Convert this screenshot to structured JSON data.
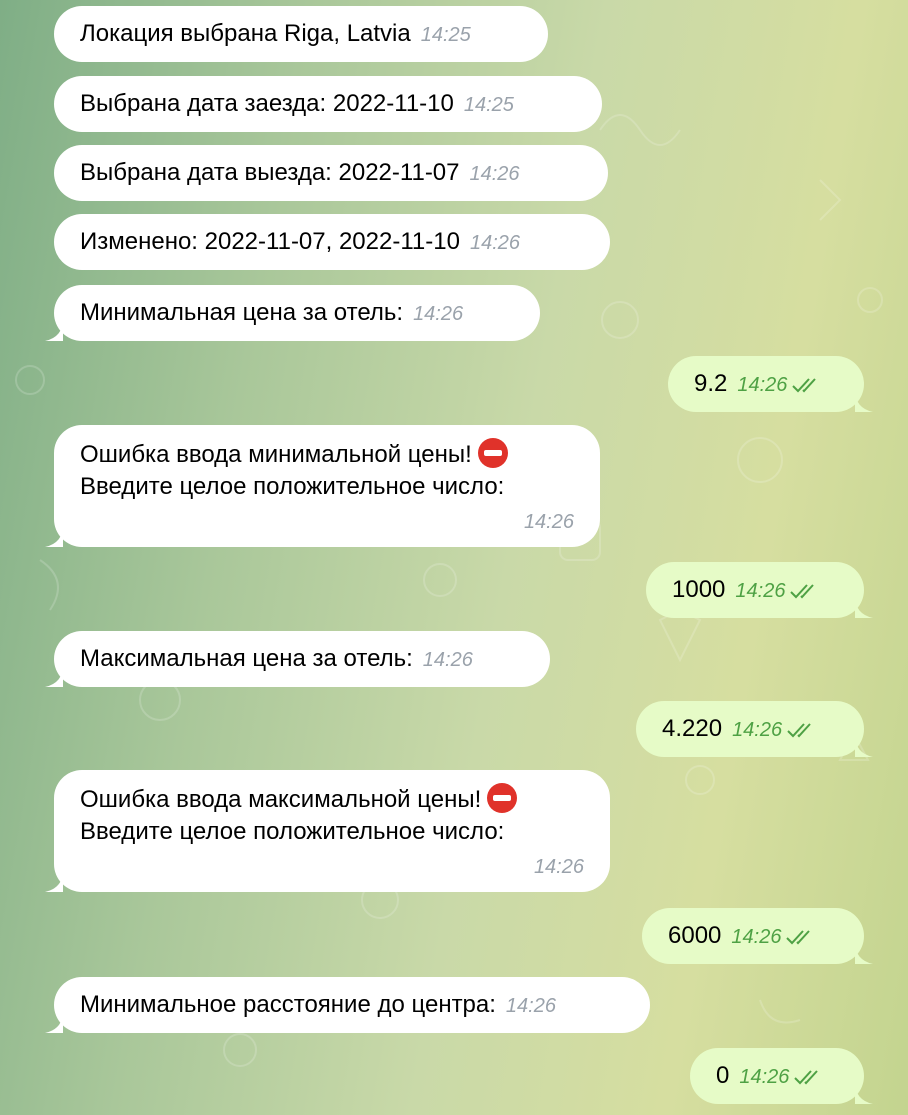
{
  "messages": [
    {
      "dir": "in",
      "text": "Локация выбрана Riga, Latvia",
      "time": "14:25"
    },
    {
      "dir": "in",
      "text": "Выбрана дата заезда: 2022-11-10",
      "time": "14:25"
    },
    {
      "dir": "in",
      "text": "Выбрана дата выезда: 2022-11-07",
      "time": "14:26"
    },
    {
      "dir": "in",
      "text": "Изменено: 2022-11-07, 2022-11-10",
      "time": "14:26"
    },
    {
      "dir": "in",
      "text": "Минимальная цена за отель:",
      "time": "14:26"
    },
    {
      "dir": "out",
      "text": "9.2",
      "time": "14:26"
    },
    {
      "dir": "in",
      "line1": "Ошибка ввода минимальной цены!",
      "line2": "Введите целое положительное число:",
      "time": "14:26"
    },
    {
      "dir": "out",
      "text": "1000",
      "time": "14:26"
    },
    {
      "dir": "in",
      "text": "Максимальная цена за отель:",
      "time": "14:26"
    },
    {
      "dir": "out",
      "text": "4.220",
      "time": "14:26"
    },
    {
      "dir": "in",
      "line1": "Ошибка ввода максимальной цены!",
      "line2": "Введите целое положительное число:",
      "time": "14:26"
    },
    {
      "dir": "out",
      "text": "6000",
      "time": "14:26"
    },
    {
      "dir": "in",
      "text": "Минимальное расстояние до центра:",
      "time": "14:26"
    },
    {
      "dir": "out",
      "text": "0",
      "time": "14:26"
    }
  ],
  "icons": {
    "read_status": "double-check-icon",
    "error_emoji": "no-entry-icon"
  },
  "colors": {
    "incoming_bubble": "#ffffff",
    "outgoing_bubble": "#e6fbc7",
    "outgoing_time": "#4ea144",
    "incoming_time": "#9aa2ab"
  }
}
